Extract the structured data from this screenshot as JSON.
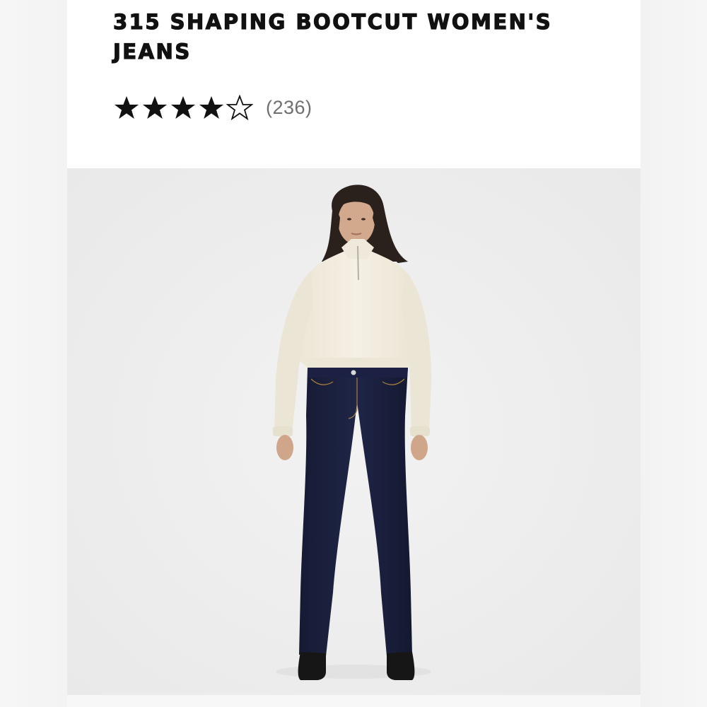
{
  "product": {
    "title": "315 SHAPING BOOTCUT WOMEN'S JEANS",
    "rating": {
      "value": 4,
      "max": 5,
      "review_count_text": "(236)"
    }
  },
  "image": {
    "subject": "model-wearing-bootcut-jeans"
  },
  "icons": {
    "filled_star": "star-filled-icon",
    "empty_star": "star-outline-icon"
  },
  "colors": {
    "title": "#111111",
    "star": "#111111",
    "review_count": "#6f6f6f",
    "photo_background": "#eeeeee",
    "denim": "#1a1f3d"
  }
}
